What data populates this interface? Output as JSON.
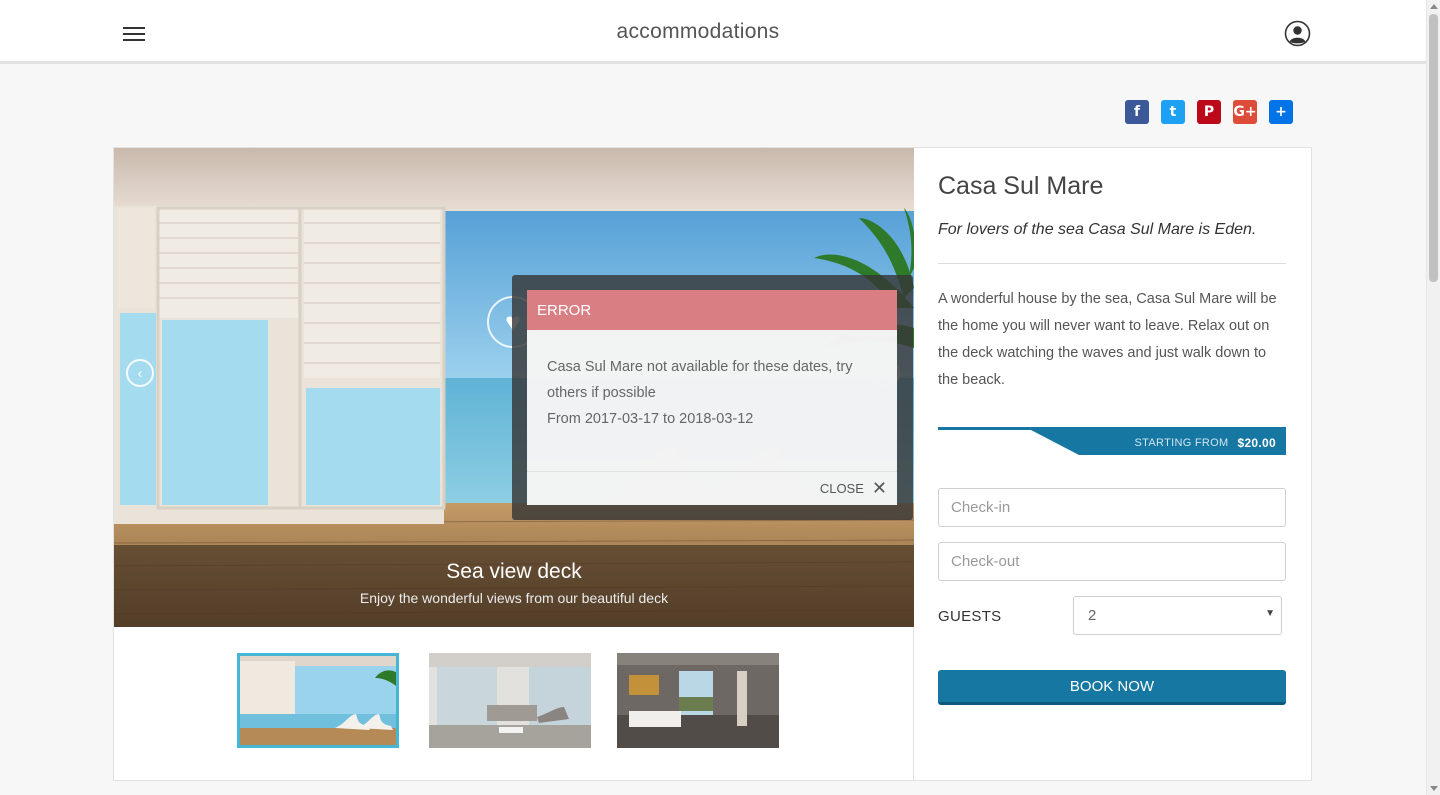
{
  "header": {
    "title": "accommodations"
  },
  "social": [
    {
      "name": "facebook",
      "glyph": "f",
      "color": "#3b5998"
    },
    {
      "name": "twitter",
      "glyph": "t",
      "color": "#1da1f2"
    },
    {
      "name": "pinterest",
      "glyph": "P",
      "color": "#bd081c"
    },
    {
      "name": "google-plus",
      "glyph": "G+",
      "color": "#dd4b39"
    },
    {
      "name": "share",
      "glyph": "+",
      "color": "#0073e6"
    }
  ],
  "slide": {
    "title": "Sea view deck",
    "subtitle": "Enjoy the wonderful views from our beautiful deck",
    "prev_icon": "‹",
    "next_icon": "›",
    "heart_icon": "♥"
  },
  "modal": {
    "title": "ERROR",
    "message": "Casa Sul Mare not available for these dates, try others if possible",
    "dates": "From 2017-03-17 to 2018-03-12",
    "close_label": "CLOSE",
    "close_icon": "✕"
  },
  "property": {
    "name": "Casa Sul Mare",
    "tagline": "For lovers of the sea Casa Sul Mare is Eden.",
    "description": "A wonderful house by the sea, Casa Sul Mare will be the home you will never want to leave. Relax out on the deck watching the waves and just walk down to the beack.",
    "price_prefix": "STARTING FROM",
    "price": "$20.00"
  },
  "booking": {
    "checkin_placeholder": "Check-in",
    "checkout_placeholder": "Check-out",
    "guests_label": "GUESTS",
    "guests_value": "2",
    "caret": "▼",
    "book_label": "BOOK NOW"
  },
  "thumbnails": [
    {
      "name": "sea-view-deck",
      "active": true
    },
    {
      "name": "living-room",
      "active": false
    },
    {
      "name": "bedroom",
      "active": false
    }
  ]
}
